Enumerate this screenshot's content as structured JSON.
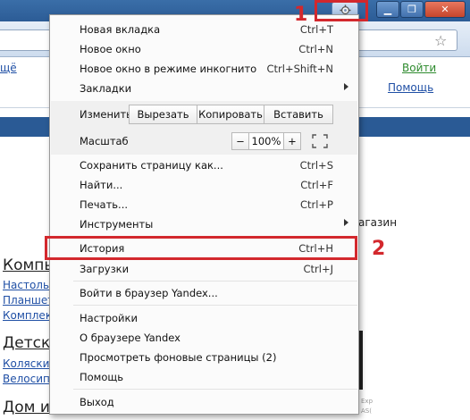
{
  "browser": {
    "window_controls": {
      "minimize": "▁",
      "maximize": "❐",
      "close": "✕"
    },
    "star_icon": "star-icon",
    "menu_icon": "gear-icon"
  },
  "page": {
    "links": {
      "fragment_top": "щё",
      "login": "Войти",
      "help": "Помощь",
      "shop_suffix": "агазин"
    },
    "categories": [
      {
        "heading": "Компь",
        "items": [
          "Настоль",
          "Планшет",
          "Комплек"
        ]
      },
      {
        "heading": "Детск",
        "items": [
          "Коляски",
          "Велосип"
        ]
      },
      {
        "heading": "Дом и",
        "items": []
      }
    ],
    "footer_fragments": [
      "Exp",
      "AS("
    ]
  },
  "menu": {
    "items_top": [
      {
        "label": "Новая вкладка",
        "shortcut": "Ctrl+T"
      },
      {
        "label": "Новое окно",
        "shortcut": "Ctrl+N"
      },
      {
        "label": "Новое окно в режиме инкогнито",
        "shortcut": "Ctrl+Shift+N"
      },
      {
        "label": "Закладки",
        "shortcut": ""
      }
    ],
    "edit": {
      "label": "Изменить",
      "cut": "Вырезать",
      "copy": "Копировать",
      "paste": "Вставить"
    },
    "zoom": {
      "label": "Масштаб",
      "minus": "−",
      "value": "100%",
      "plus": "+"
    },
    "items_mid": [
      {
        "label": "Сохранить страницу как...",
        "shortcut": "Ctrl+S"
      },
      {
        "label": "Найти...",
        "shortcut": "Ctrl+F"
      },
      {
        "label": "Печать...",
        "shortcut": "Ctrl+P"
      },
      {
        "label": "Инструменты",
        "shortcut": ""
      }
    ],
    "items_history": [
      {
        "label": "История",
        "shortcut": "Ctrl+H"
      },
      {
        "label": "Загрузки",
        "shortcut": "Ctrl+J"
      }
    ],
    "signin": "Войти в браузер Yandex...",
    "items_bottom": [
      {
        "label": "Настройки"
      },
      {
        "label": "О браузере Yandex"
      },
      {
        "label": "Просмотреть фоновые страницы (2)"
      },
      {
        "label": "Помощь"
      }
    ],
    "exit": "Выход"
  },
  "annotations": {
    "one": "1",
    "two": "2",
    "color": "#d3282d"
  }
}
